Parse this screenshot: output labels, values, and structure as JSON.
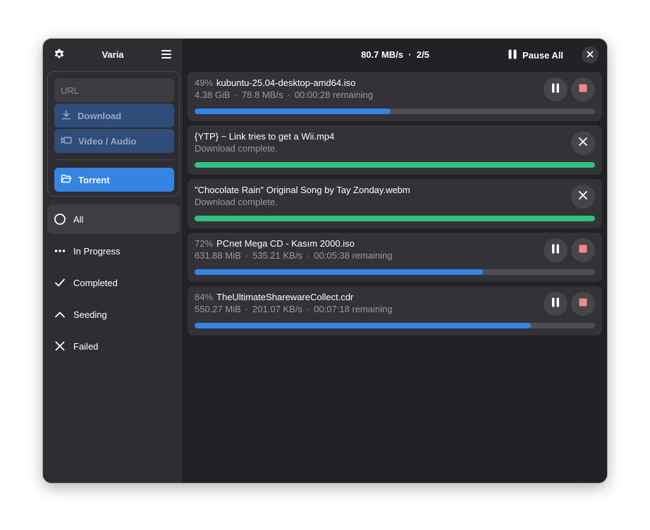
{
  "app": {
    "title": "Varia"
  },
  "add": {
    "url_placeholder": "URL",
    "download_label": "Download",
    "video_label": "Video / Audio",
    "torrent_label": "Torrent"
  },
  "filters": [
    {
      "label": "All",
      "icon": "circle-icon",
      "active": true
    },
    {
      "label": "In Progress",
      "icon": "dots-icon"
    },
    {
      "label": "Completed",
      "icon": "check-icon"
    },
    {
      "label": "Seeding",
      "icon": "chevron-up-icon"
    },
    {
      "label": "Failed",
      "icon": "x-icon"
    }
  ],
  "header": {
    "speed": "80.7 MB/s",
    "count": "2/5",
    "pause_all_label": "Pause All"
  },
  "downloads": [
    {
      "percent_label": "49%",
      "progress": 0.49,
      "name": "kubuntu-25.04-desktop-amd64.iso",
      "size": "4.38 GiB",
      "speed": "78.8  MB/s",
      "remaining": "00:00:28 remaining",
      "state": "downloading"
    },
    {
      "percent_label": "",
      "progress": 1.0,
      "name": "{YTP} ~ Link tries to get a Wii.mp4",
      "status": "Download complete.",
      "state": "complete"
    },
    {
      "percent_label": "",
      "progress": 1.0,
      "name": "\"Chocolate Rain\" Original Song by Tay Zonday.webm",
      "status": "Download complete.",
      "state": "complete"
    },
    {
      "percent_label": "72%",
      "progress": 0.72,
      "name": "PCnet Mega CD - Kasım 2000.iso",
      "size": "631.88 MiB",
      "speed": "535.21  KB/s",
      "remaining": "00:05:38 remaining",
      "state": "downloading"
    },
    {
      "percent_label": "84%",
      "progress": 0.84,
      "name": "TheUltimateSharewareCollect.cdr",
      "size": "550.27 MiB",
      "speed": "201.07  KB/s",
      "remaining": "00:07:18 remaining",
      "state": "downloading"
    }
  ],
  "colors": {
    "accent": "#3584e4",
    "complete": "#2ec27e",
    "stop": "#f08a84",
    "card": "#333337"
  }
}
